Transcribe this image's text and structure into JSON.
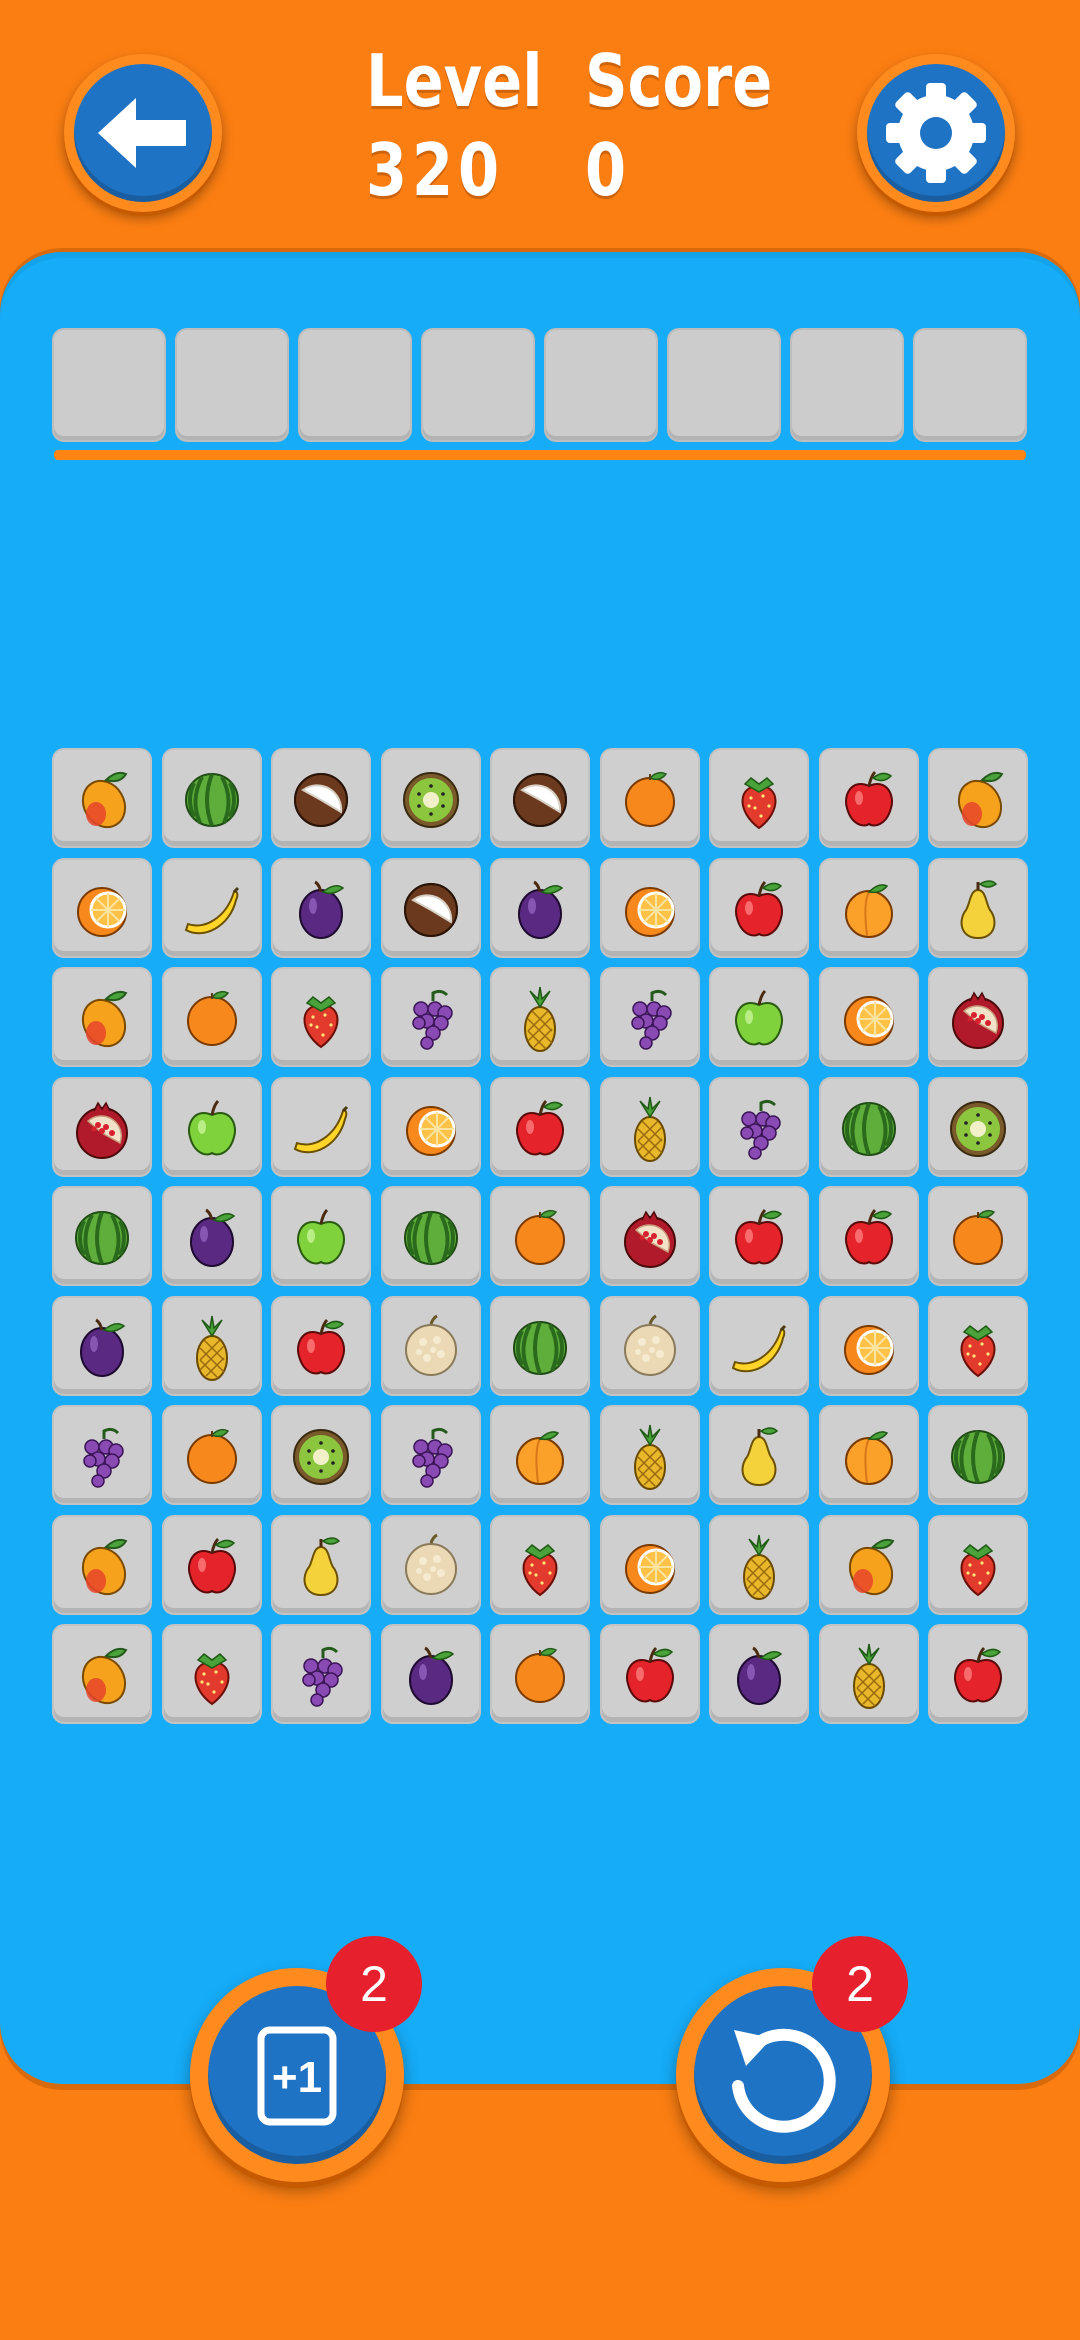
{
  "header": {
    "level_label": "Level",
    "level_value": "320",
    "score_label": "Score",
    "score_value": "0",
    "back_icon": "arrow-left-icon",
    "settings_icon": "gear-icon"
  },
  "slot_tray": {
    "slot_count": 8,
    "filled": 0
  },
  "colors": {
    "background": "#fb7e12",
    "board": "#16acf8",
    "button": "#1f73c4",
    "badge": "#e7202d",
    "tile": "#cfcfcf"
  },
  "grid": {
    "rows": [
      [
        "mango",
        "watermelon",
        "coconut",
        "kiwi",
        "coconut",
        "orange",
        "strawberry",
        "red-apple",
        "mango"
      ],
      [
        "orange-half",
        "banana",
        "plum",
        "coconut",
        "plum",
        "orange-half",
        "red-apple",
        "apricot",
        "pear"
      ],
      [
        "mango",
        "orange",
        "strawberry",
        "grapes",
        "pineapple",
        "grapes",
        "green-apple",
        "orange-half",
        "pomegranate"
      ],
      [
        "pomegranate",
        "green-apple",
        "banana",
        "orange-half",
        "red-apple",
        "pineapple",
        "grapes",
        "watermelon",
        "kiwi"
      ],
      [
        "watermelon",
        "plum",
        "green-apple",
        "watermelon",
        "orange",
        "pomegranate",
        "red-apple",
        "red-apple",
        "orange"
      ],
      [
        "plum",
        "pineapple",
        "red-apple",
        "melon",
        "watermelon",
        "melon",
        "banana",
        "orange-half",
        "strawberry"
      ],
      [
        "grapes",
        "orange",
        "kiwi",
        "grapes",
        "apricot",
        "pineapple",
        "pear",
        "apricot",
        "watermelon"
      ],
      [
        "mango",
        "red-apple",
        "pear",
        "melon",
        "strawberry",
        "orange-half",
        "pineapple",
        "mango",
        "strawberry"
      ],
      [
        "mango",
        "strawberry",
        "grapes",
        "plum",
        "orange",
        "red-apple",
        "plum",
        "pineapple",
        "red-apple"
      ]
    ]
  },
  "powerups": {
    "add_slot": {
      "icon": "plus-one-card-icon",
      "label": "+1",
      "count": "2"
    },
    "undo": {
      "icon": "undo-icon",
      "count": "2"
    }
  }
}
